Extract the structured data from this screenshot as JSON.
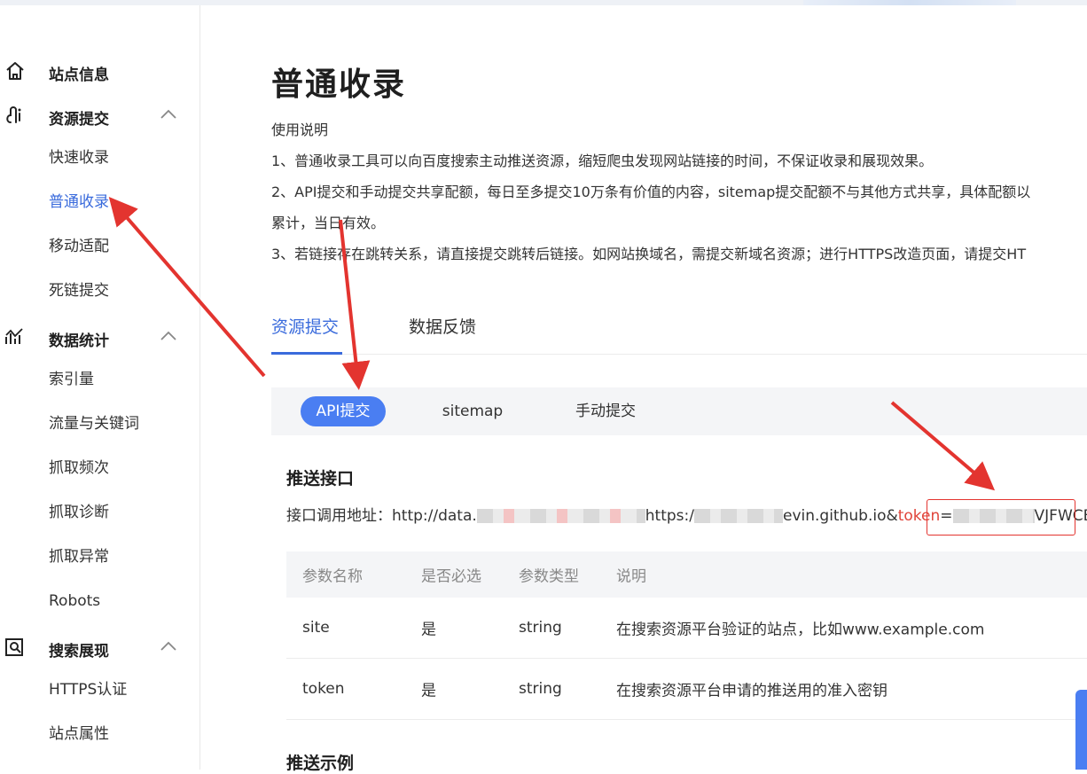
{
  "sidebar": {
    "groups": [
      {
        "label": "站点信息",
        "icon": "home-icon",
        "items": []
      },
      {
        "label": "资源提交",
        "icon": "submit-icon",
        "items": [
          "快速收录",
          "普通收录",
          "移动适配",
          "死链提交"
        ]
      },
      {
        "label": "数据统计",
        "icon": "chart-icon",
        "items": [
          "索引量",
          "流量与关键词",
          "抓取频次",
          "抓取诊断",
          "抓取异常",
          "Robots"
        ]
      },
      {
        "label": "搜索展现",
        "icon": "search-display-icon",
        "items": [
          "HTTPS认证",
          "站点属性"
        ]
      }
    ],
    "active_item": "普通收录"
  },
  "page": {
    "title": "普通收录",
    "desc_heading": "使用说明",
    "desc_lines": [
      "1、普通收录工具可以向百度搜索主动推送资源，缩短爬虫发现网站链接的时间，不保证收录和展现效果。",
      "2、API提交和手动提交共享配额，每日至多提交10万条有价值的内容，sitemap提交配额不与其他方式共享，具体配额以",
      "累计，当日有效。",
      "3、若链接存在跳转关系，请直接提交跳转后链接。如网站换域名，需提交新域名资源；进行HTTPS改造页面，请提交HT"
    ]
  },
  "tabs": [
    "资源提交",
    "数据反馈"
  ],
  "subtabs": [
    "API提交",
    "sitemap",
    "手动提交"
  ],
  "push_api": {
    "section_title": "推送接口",
    "addr_label": "接口调用地址：",
    "addr_part1": "http://data.",
    "addr_part2": "https:/",
    "addr_part3": "evin.github.io&",
    "token_word": "token",
    "addr_part4": "=",
    "token_tail": "VJFWCE"
  },
  "params_table": {
    "headers": [
      "参数名称",
      "是否必选",
      "参数类型",
      "说明"
    ],
    "rows": [
      [
        "site",
        "是",
        "string",
        "在搜索资源平台验证的站点，比如www.example.com"
      ],
      [
        "token",
        "是",
        "string",
        "在搜索资源平台申请的推送用的准入密钥"
      ]
    ]
  },
  "next_section": "推送示例",
  "colors": {
    "accent": "#3a6bdc",
    "pill": "#4a7ef2",
    "annotation": "#e3342f"
  }
}
